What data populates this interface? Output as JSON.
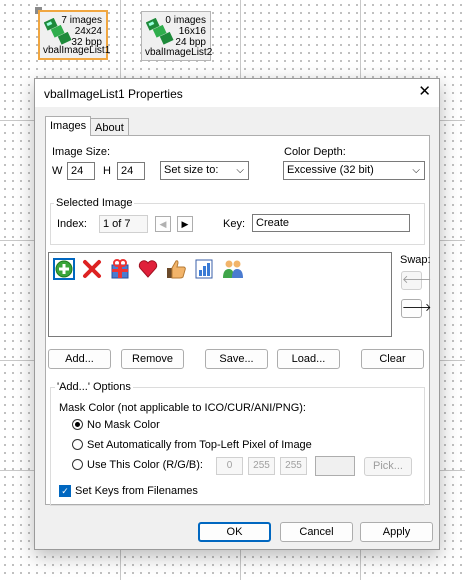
{
  "components": [
    {
      "name": "vbalImageList1",
      "lines": [
        "7 images",
        "24x24",
        "32 bpp"
      ]
    },
    {
      "name": "vbalImageList2",
      "lines": [
        "0 images",
        "16x16",
        "24 bpp"
      ]
    }
  ],
  "dialog": {
    "title": "vbalImageList1 Properties",
    "tabs": [
      "Images",
      "About"
    ],
    "image_size": {
      "label": "Image Size:",
      "w_label": "W",
      "w_value": "24",
      "h_label": "H",
      "h_value": "24",
      "set_size_to": "Set size to:"
    },
    "color_depth": {
      "label": "Color Depth:",
      "value": "Excessive (32 bit)"
    },
    "selected_image": {
      "title": "Selected Image",
      "index_label": "Index:",
      "index_value": "1 of 7",
      "key_label": "Key:",
      "key_value": "Create"
    },
    "image_icons": [
      "add-icon",
      "delete-icon",
      "gift-icon",
      "heart-icon",
      "thumbs-up-icon",
      "report-icon",
      "users-icon"
    ],
    "swap_label": "Swap:",
    "buttons": {
      "add": "Add...",
      "remove": "Remove",
      "save": "Save...",
      "load": "Load...",
      "clear": "Clear"
    },
    "add_options": {
      "title": "'Add...' Options",
      "mask_label": "Mask Color (not applicable to ICO/CUR/ANI/PNG):",
      "radios": [
        "No Mask Color",
        "Set Automatically from Top-Left Pixel of Image",
        "Use This Color (R/G/B):"
      ],
      "selected_radio": 0,
      "rgb": [
        "0",
        "255",
        "255"
      ],
      "pick_label": "Pick...",
      "keys_checkbox": "Set Keys from Filenames",
      "keys_checked": true
    },
    "footer": {
      "ok": "OK",
      "cancel": "Cancel",
      "apply": "Apply"
    }
  },
  "colors": {
    "accent": "#0067c0",
    "selection_handle": "#f0a640"
  }
}
